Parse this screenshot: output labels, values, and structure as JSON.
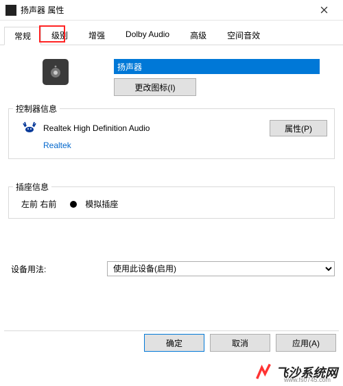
{
  "titlebar": {
    "title": "扬声器 属性"
  },
  "tabs": {
    "items": [
      "常规",
      "级别",
      "增强",
      "Dolby Audio",
      "高级",
      "空间音效"
    ],
    "active_index": 0,
    "highlighted_index": 1
  },
  "device": {
    "name_value": "扬声器",
    "change_icon_label": "更改图标(I)"
  },
  "controller": {
    "group_label": "控制器信息",
    "name": "Realtek High Definition Audio",
    "vendor": "Realtek",
    "props_btn": "属性(P)"
  },
  "jack": {
    "group_label": "插座信息",
    "lr_label": "左前 右前",
    "type_label": "模拟插座"
  },
  "usage": {
    "label": "设备用法:",
    "value": "使用此设备(启用)"
  },
  "buttons": {
    "ok": "确定",
    "cancel": "取消",
    "apply": "应用(A)"
  },
  "watermark": {
    "text": "飞沙系统网",
    "sub": "www.fs0745.com"
  }
}
